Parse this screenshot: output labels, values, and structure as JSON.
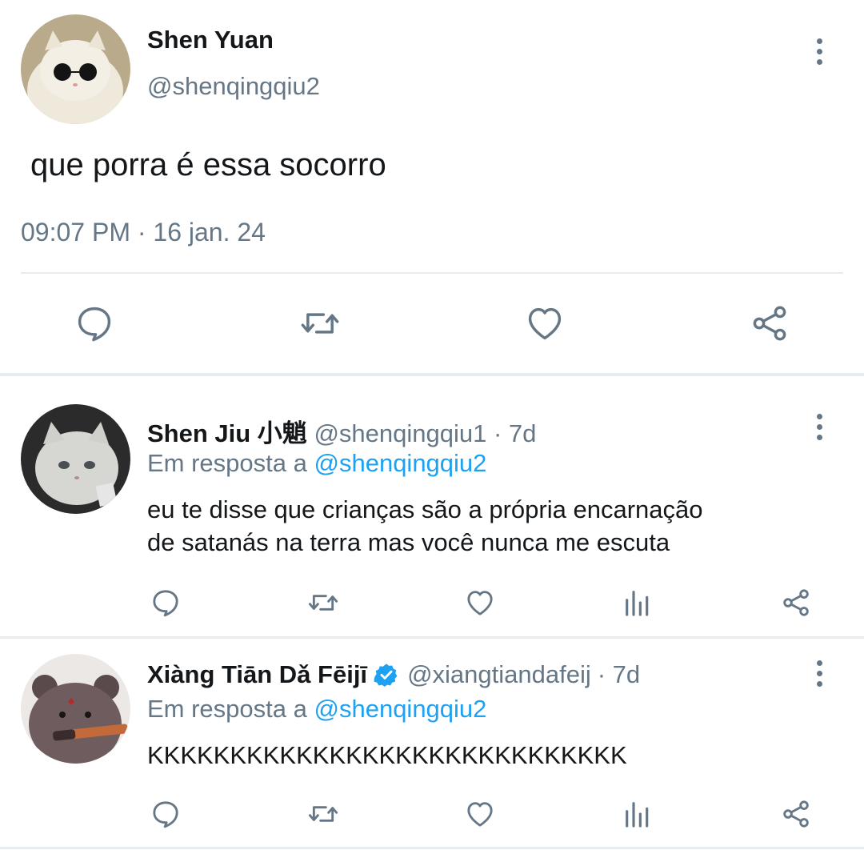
{
  "main_tweet": {
    "display_name": "Shen Yuan",
    "handle": "@shenqingqiu2",
    "text": "que porra é essa socorro",
    "timestamp": "09:07 PM · 16 jan. 24",
    "actions": [
      "reply-icon",
      "retweet-icon",
      "like-icon",
      "share-icon"
    ]
  },
  "replies": [
    {
      "display_name": "Shen Jiu 小魈",
      "handle": "@shenqingqiu1",
      "age": "· 7d",
      "reply_prefix": "Em resposta a",
      "reply_to": "@shenqingqiu2",
      "text_line1": "eu te disse que crianças são a própria encarnação",
      "text_line2": "de satanás na terra mas você nunca me escuta",
      "verified": false
    },
    {
      "display_name": "Xiàng Tiān Dǎ Fēijī",
      "handle": "@xiangtiandafeij",
      "age": "· 7d",
      "reply_prefix": "Em resposta a",
      "reply_to": "@shenqingqiu2",
      "text_line1": "KKKKKKKKKKKKKKKKKKKKKKKKKKKKK",
      "verified": true
    }
  ],
  "colors": {
    "accent": "#1da1f2",
    "secondary_text": "#657786",
    "divider": "#e6ecf0"
  }
}
